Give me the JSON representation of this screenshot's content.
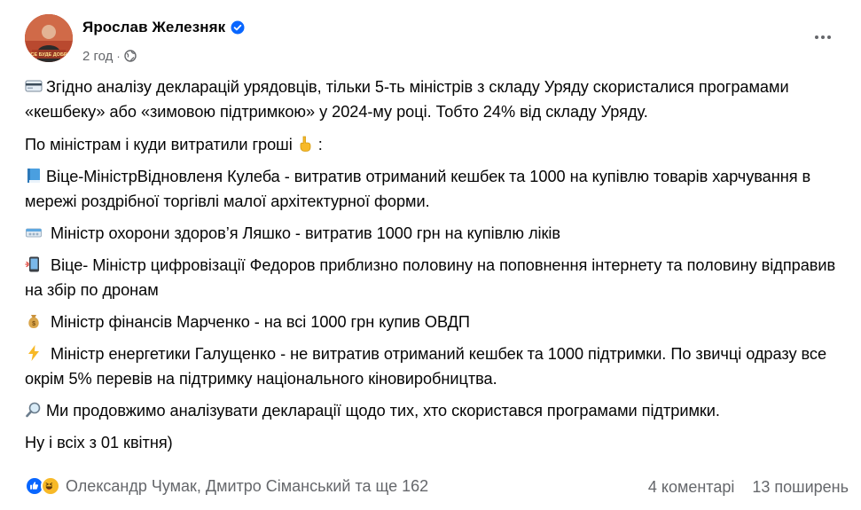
{
  "post": {
    "author": "Ярослав Железняк",
    "time": "2 год",
    "meta_separator": "·",
    "icons": {
      "verified": "verified-badge-icon",
      "audience": "globe-icon",
      "menu": "more-options-icon"
    },
    "avatar_text": "ВСЕ БУДЕ ДОБРЕ",
    "paragraphs": [
      {
        "emoji": "credit-card-icon",
        "text": "Згідно аналізу декларацій урядовців, тільки 5-ть міністрів з складу Уряду скористалися програмами «кешбеку» або «зимовою підтримкою» у 2024-му році. Тобто 24% від складу Уряду."
      },
      {
        "emoji": "",
        "text": "По міністрам і куди витратили гроші",
        "suffix_emoji": "pointing-down-hand-icon",
        "suffix": " :"
      },
      {
        "emoji": "blue-book-icon",
        "text": "Віце-МіністрВідновленя Кулеба - витратив отриманий кешбек та 1000 на купівлю товарів харчування в мережі роздрібної торгівлі малої архітектурної форми."
      },
      {
        "emoji": "pill-box-icon",
        "text": " Міністр охорони здоров’я Ляшко - витратив 1000 грн на купівлю ліків"
      },
      {
        "emoji": "mobile-phone-icon",
        "text": " Віце- Міністр цифровізації Федоров приблизно половину на поповнення інтернету та половину відправив на збір по дронам"
      },
      {
        "emoji": "money-bag-icon",
        "text": " Міністр фінансів Марченко - на всі 1000 грн купив ОВДП"
      },
      {
        "emoji": "lightning-icon",
        "text": " Міністр енергетики Галущенко - не витратив отриманий кешбек та 1000 підтримки. По звичці одразу все окрім 5% перевів на підтримку національного кіновиробництва."
      },
      {
        "emoji": "magnifier-icon",
        "text": "Ми продовжимо аналізувати декларації щодо тих, хто скористався програмами підтримки."
      },
      {
        "emoji": "",
        "text": "Ну і всіх з 01 квітня)"
      }
    ],
    "footer": {
      "reaction_icons": [
        "like-icon",
        "haha-icon"
      ],
      "reactors": "Олександр Чумак, Дмитро Сіманський та ще 162",
      "comments": "4 коментарі",
      "shares": "13 поширень"
    },
    "colors": {
      "text": "#050505",
      "secondary": "#65676b",
      "verified": "#0866ff",
      "like": "#0866ff",
      "haha": "#f7b928"
    }
  }
}
